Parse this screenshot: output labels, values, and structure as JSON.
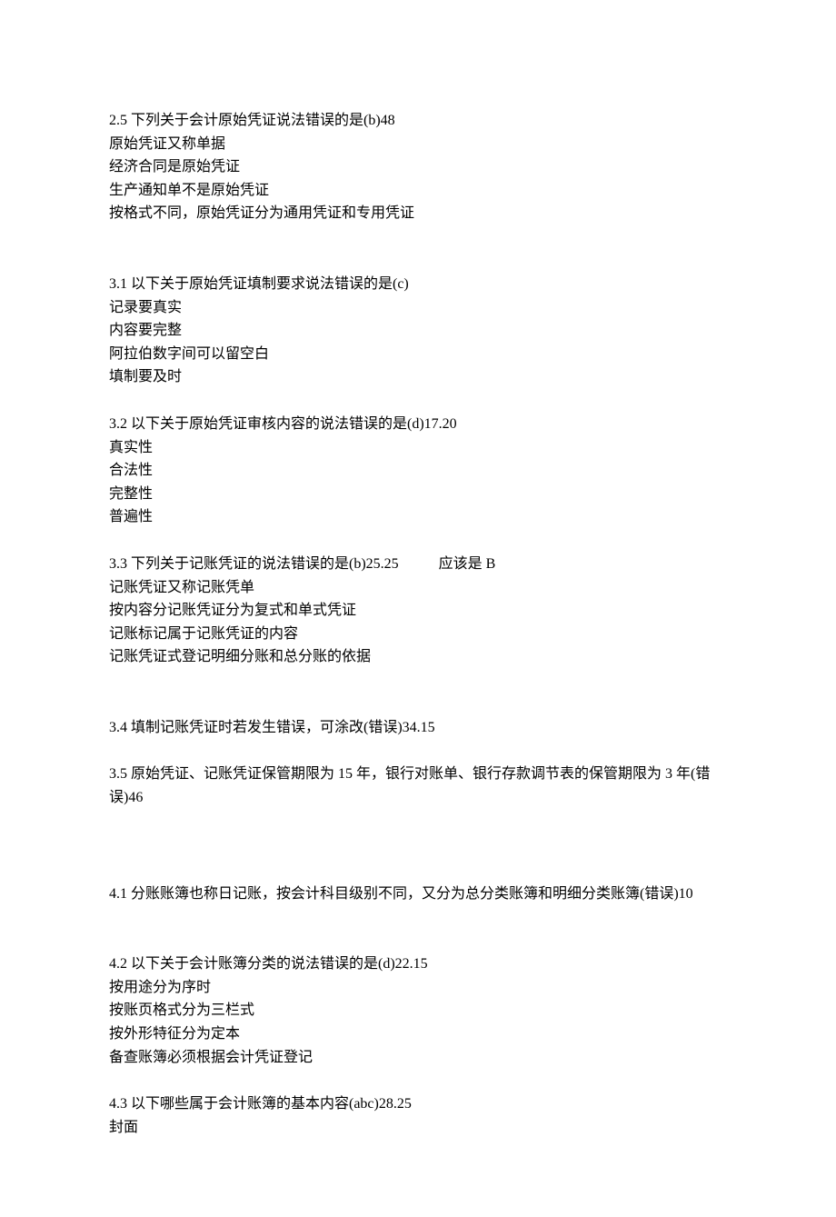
{
  "questions": [
    {
      "title": "2.5 下列关于会计原始凭证说法错误的是(b)48",
      "options": [
        "原始凭证又称单据",
        "经济合同是原始凭证",
        "生产通知单不是原始凭证",
        "按格式不同，原始凭证分为通用凭证和专用凭证"
      ],
      "gap": "big"
    },
    {
      "title": "3.1 以下关于原始凭证填制要求说法错误的是(c)",
      "options": [
        "记录要真实",
        "内容要完整",
        "阿拉伯数字间可以留空白",
        "填制要及时"
      ],
      "gap": "normal"
    },
    {
      "title": "3.2 以下关于原始凭证审核内容的说法错误的是(d)17.20",
      "options": [
        "真实性",
        "合法性",
        "完整性",
        "普遍性"
      ],
      "gap": "normal"
    },
    {
      "title": "3.3 下列关于记账凭证的说法错误的是(b)25.25           应该是 B",
      "options": [
        "记账凭证又称记账凭单",
        "按内容分记账凭证分为复式和单式凭证",
        "记账标记属于记账凭证的内容",
        "记账凭证式登记明细分账和总分账的依据"
      ],
      "gap": "big"
    },
    {
      "title": "3.4 填制记账凭证时若发生错误，可涂改(错误)34.15",
      "options": [],
      "gap": "normal"
    },
    {
      "title": "3.5 原始凭证、记账凭证保管期限为 15 年，银行对账单、银行存款调节表的保管期限为 3 年(错误)46",
      "options": [],
      "gap": "huge"
    },
    {
      "title": "4.1 分账账簿也称日记账，按会计科目级别不同，又分为总分类账簿和明细分类账簿(错误)10",
      "options": [],
      "gap": "big"
    },
    {
      "title": "4.2 以下关于会计账簿分类的说法错误的是(d)22.15",
      "options": [
        "按用途分为序时",
        "按账页格式分为三栏式",
        "按外形特征分为定本",
        "备查账簿必须根据会计凭证登记"
      ],
      "gap": "normal"
    },
    {
      "title": "4.3 以下哪些属于会计账簿的基本内容(abc)28.25",
      "options": [
        "封面"
      ],
      "gap": "normal"
    }
  ]
}
